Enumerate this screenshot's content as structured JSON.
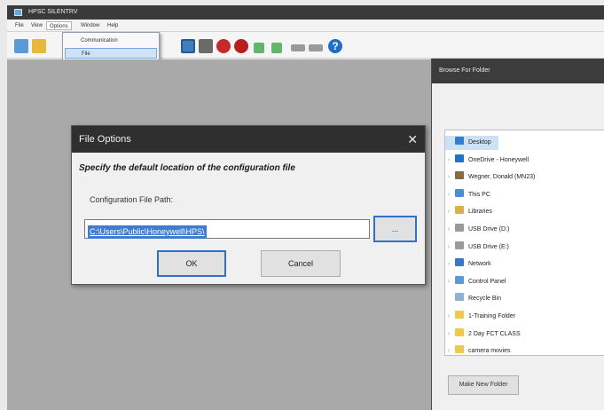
{
  "app": {
    "title": "HPSC SILENTRV",
    "menu": [
      "File",
      "View",
      "Options",
      "Window",
      "Help"
    ]
  },
  "options_menu": {
    "items": [
      "Communication",
      "File"
    ],
    "highlighted": "File"
  },
  "file_options_dialog": {
    "title": "File Options",
    "close_glyph": "✕",
    "heading": "Specify the default location of the configuration file",
    "path_label": "Configuration File Path:",
    "path_value": "C:\\Users\\Public\\Honeywell\\HPS\\",
    "browse_label": "...",
    "ok_label": "OK",
    "cancel_label": "Cancel"
  },
  "browse_dialog": {
    "title": "Browse For Folder",
    "tree": [
      {
        "label": "Desktop",
        "icon": "desktop-icon",
        "color": "#2f7fd4",
        "selected": true,
        "expander": ""
      },
      {
        "label": "OneDrive - Honeywell",
        "icon": "cloud-icon",
        "color": "#1e72c8",
        "expander": "›"
      },
      {
        "label": "Wegner, Donald (MN23)",
        "icon": "user-icon",
        "color": "#8a6a40",
        "expander": "›"
      },
      {
        "label": "This PC",
        "icon": "computer-icon",
        "color": "#4a8fd6",
        "expander": "›"
      },
      {
        "label": "Libraries",
        "icon": "libraries-icon",
        "color": "#d9b04a",
        "expander": "›"
      },
      {
        "label": "USB Drive (D:)",
        "icon": "usb-drive-icon",
        "color": "#9a9a9a",
        "expander": "›"
      },
      {
        "label": "USB Drive (E:)",
        "icon": "usb-drive-icon",
        "color": "#9a9a9a",
        "expander": "›"
      },
      {
        "label": "Network",
        "icon": "network-icon",
        "color": "#3b78c4",
        "expander": "›"
      },
      {
        "label": "Control Panel",
        "icon": "control-panel-icon",
        "color": "#5a9ad8",
        "expander": "›"
      },
      {
        "label": "Recycle Bin",
        "icon": "recycle-bin-icon",
        "color": "#8fb2d6",
        "expander": ""
      },
      {
        "label": "1-Training Folder",
        "icon": "folder-icon",
        "color": "#f0c84a",
        "expander": "›"
      },
      {
        "label": "2 Day FCT CLASS",
        "icon": "folder-icon",
        "color": "#f0c84a",
        "expander": "›"
      },
      {
        "label": "camera movies",
        "icon": "folder-icon",
        "color": "#f0c84a",
        "expander": "›"
      }
    ],
    "make_new_folder_label": "Make New Folder"
  },
  "toolbar_icons": [
    "open-icon",
    "save-icon",
    "image-icon",
    "print-icon",
    "record-red-icon",
    "stop-red-icon",
    "connect-icon",
    "disconnect-icon",
    "network-icon",
    "report-icon",
    "help-icon"
  ]
}
